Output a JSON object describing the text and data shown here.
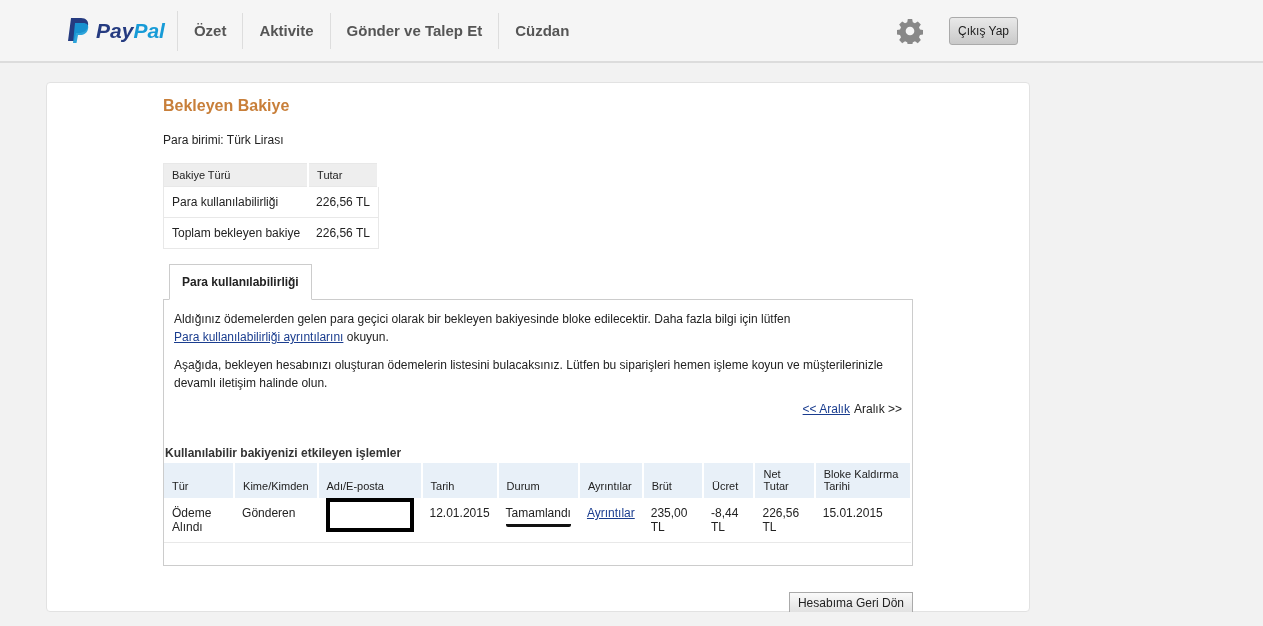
{
  "header": {
    "logo": {
      "pay": "Pay",
      "pal": "Pal"
    },
    "nav": [
      {
        "label": "Özet",
        "selected": false
      },
      {
        "label": "Aktivite",
        "selected": false
      },
      {
        "label": "Gönder ve Talep Et",
        "selected": false
      },
      {
        "label": "Cüzdan",
        "selected": false
      }
    ],
    "logout": "Çıkış Yap"
  },
  "title": "Bekleyen Bakiye",
  "currency": "Para birimi: Türk Lirası",
  "balance_table": {
    "columns": [
      "Bakiye Türü",
      "Tutar"
    ],
    "rows": [
      [
        "Para kullanılabilirliği",
        "226,56 TL"
      ],
      [
        "Toplam bekleyen bakiye",
        "226,56 TL"
      ]
    ]
  },
  "tabs": [
    {
      "label": "Para kullanılabilirliği",
      "selected": true
    }
  ],
  "info": {
    "before": "Aldığınız ödemelerden gelen para geçici olarak bir bekleyen bakiyesinde bloke edilecektir. Daha fazla bilgi için lütfen",
    "link": "Para kullanılabilirliği ayrıntılarını",
    "after": "okuyun."
  },
  "info_2": "Aşağıda, bekleyen hesabınızı oluşturan ödemelerin listesini bulacaksınız. Lütfen bu siparişleri hemen işleme koyun ve müşterilerinizle devamlı iletişim halinde olun.",
  "pager": {
    "prev": "<< Aralık",
    "next": "Aralık >>"
  },
  "transactions": {
    "title": "Kullanılabilir bakiyenizi etkileyen işlemler",
    "columns": [
      "Tür",
      "Kime/Kimden",
      "Adı/E-posta",
      "Tarih",
      "Durum",
      "Ayrıntılar",
      "Brüt",
      "Ücret",
      "Net Tutar",
      "Bloke Kaldırma Tarihi"
    ],
    "rows": [
      [
        {
          "kind": "text",
          "text": "Ödeme Alındı"
        },
        {
          "kind": "text",
          "text": "Gönderen"
        },
        {
          "kind": "redacted"
        },
        {
          "kind": "text",
          "text": "12.01.2015"
        },
        {
          "kind": "marked",
          "text": "Tamamlandı"
        },
        {
          "kind": "link",
          "text": "Ayrıntılar"
        },
        {
          "kind": "text",
          "text": "235,00 TL"
        },
        {
          "kind": "text",
          "text": "-8,44 TL"
        },
        {
          "kind": "text",
          "text": "226,56 TL"
        },
        {
          "kind": "text",
          "text": "15.01.2015"
        }
      ]
    ]
  },
  "back_button": "Hesabıma Geri Dön"
}
